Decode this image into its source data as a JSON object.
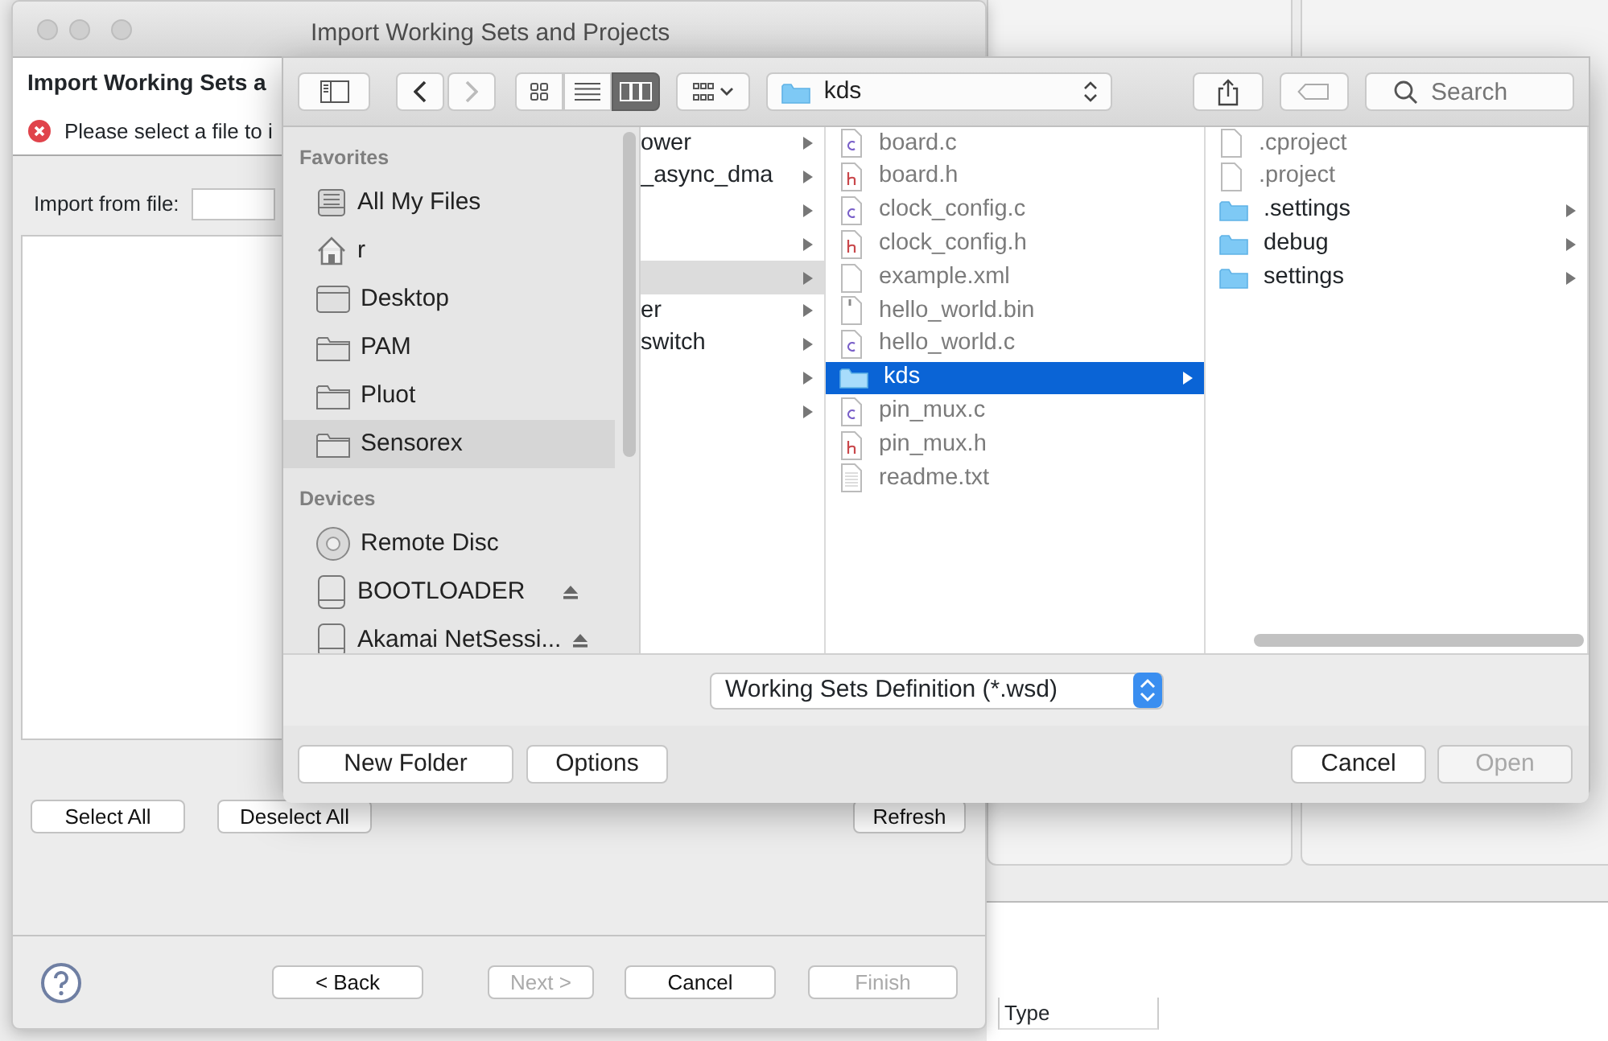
{
  "wizard": {
    "title": "Import Working Sets and Projects",
    "heading": "Import Working Sets a",
    "error_message": "Please select a file to i",
    "import_label": "Import from file:",
    "list_buttons": [
      {
        "label": "Select All"
      },
      {
        "label": "Deselect All"
      },
      {
        "label": "Refresh"
      }
    ],
    "footer_buttons": [
      {
        "label": "< Back",
        "disabled": false
      },
      {
        "label": "Next >",
        "disabled": true
      },
      {
        "label": "Cancel",
        "disabled": false
      },
      {
        "label": "Finish",
        "disabled": true
      }
    ]
  },
  "behind_table": {
    "columns": [
      "Type"
    ]
  },
  "file_dialog": {
    "toolbar": {
      "nav": [
        {
          "kind": "back",
          "disabled": false
        },
        {
          "kind": "forward",
          "disabled": true
        }
      ],
      "views": [
        {
          "kind": "icons",
          "selected": false
        },
        {
          "kind": "list",
          "selected": false
        },
        {
          "kind": "columns",
          "selected": true
        }
      ],
      "location": "kds",
      "search": {
        "placeholder": "Search"
      }
    },
    "sidebar": [
      {
        "title": "Favorites",
        "items": [
          {
            "label": "All My Files",
            "kind": "all-files",
            "selected": false
          },
          {
            "label": "r",
            "kind": "home",
            "selected": false
          },
          {
            "label": "Desktop",
            "kind": "desktop",
            "selected": false
          },
          {
            "label": "PAM",
            "kind": "folder",
            "selected": false
          },
          {
            "label": "Pluot",
            "kind": "folder",
            "selected": false
          },
          {
            "label": "Sensorex",
            "kind": "folder",
            "selected": true
          }
        ]
      },
      {
        "title": "Devices",
        "items": [
          {
            "label": "Remote Disc",
            "kind": "disc",
            "selected": false
          },
          {
            "label": "BOOTLOADER",
            "kind": "drive",
            "ejectable": true,
            "selected": false
          },
          {
            "label": "Akamai NetSessi...",
            "kind": "drive",
            "ejectable": true,
            "selected": false
          }
        ]
      }
    ],
    "columns": [
      {
        "items": [
          {
            "name": "ower",
            "kind": "folder-cut",
            "selected": false
          },
          {
            "name": "_async_dma",
            "kind": "folder-cut",
            "selected": false
          },
          {
            "kind": "folder-cut",
            "selected": false
          },
          {
            "kind": "folder-cut",
            "selected": false
          },
          {
            "kind": "folder-cut",
            "selected": true
          },
          {
            "name": "er",
            "kind": "folder-cut",
            "selected": false
          },
          {
            "name": "switch",
            "kind": "folder-cut",
            "selected": false
          },
          {
            "kind": "folder-cut",
            "selected": false
          },
          {
            "kind": "folder-cut",
            "selected": false
          }
        ]
      },
      {
        "items": [
          {
            "name": "board.c",
            "kind": "c",
            "disabled": true,
            "selected": false
          },
          {
            "name": "board.h",
            "kind": "h",
            "disabled": true,
            "selected": false
          },
          {
            "name": "clock_config.c",
            "kind": "c",
            "disabled": true,
            "selected": false
          },
          {
            "name": "clock_config.h",
            "kind": "h",
            "disabled": true,
            "selected": false
          },
          {
            "name": "example.xml",
            "kind": "file",
            "disabled": true,
            "selected": false
          },
          {
            "name": "hello_world.bin",
            "kind": "binary",
            "disabled": true,
            "selected": false
          },
          {
            "name": "hello_world.c",
            "kind": "c",
            "disabled": true,
            "selected": false
          },
          {
            "name": "kds",
            "kind": "folder",
            "disabled": false,
            "selected": true
          },
          {
            "name": "pin_mux.c",
            "kind": "c",
            "disabled": true,
            "selected": false
          },
          {
            "name": "pin_mux.h",
            "kind": "h",
            "disabled": true,
            "selected": false
          },
          {
            "name": "readme.txt",
            "kind": "text",
            "disabled": true,
            "selected": false
          }
        ]
      },
      {
        "items": [
          {
            "name": ".cproject",
            "kind": "file",
            "disabled": true,
            "selected": false
          },
          {
            "name": ".project",
            "kind": "file",
            "disabled": true,
            "selected": false
          },
          {
            "name": ".settings",
            "kind": "folder",
            "disabled": false,
            "selected": false
          },
          {
            "name": "debug",
            "kind": "folder",
            "disabled": false,
            "selected": false
          },
          {
            "name": "settings",
            "kind": "folder",
            "disabled": false,
            "selected": false
          }
        ]
      }
    ],
    "format": "Working Sets Definition (*.wsd)",
    "buttons": [
      {
        "label": "New Folder",
        "disabled": false
      },
      {
        "label": "Options",
        "disabled": false
      },
      {
        "label": "Cancel",
        "disabled": false
      },
      {
        "label": "Open",
        "disabled": true
      }
    ]
  }
}
